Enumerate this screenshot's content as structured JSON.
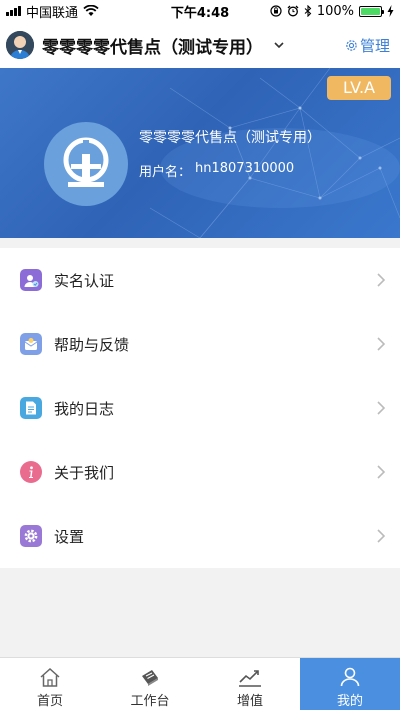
{
  "status_bar": {
    "carrier": "中国联通",
    "time": "下午4:48",
    "battery_percent": "100%",
    "battery_level": 1.0
  },
  "header": {
    "title": "零零零零代售点（测试专用）",
    "manage_label": "管理"
  },
  "banner": {
    "level_badge": "LV.A",
    "name": "零零零零代售点（测试专用）",
    "username_label": "用户名：",
    "username": "hn1807310000"
  },
  "menu": {
    "items": [
      {
        "label": "实名认证",
        "icon": "id-verify-icon",
        "color": "#8c6cd6"
      },
      {
        "label": "帮助与反馈",
        "icon": "help-feedback-icon",
        "color": "#7fa0e6"
      },
      {
        "label": "我的日志",
        "icon": "log-icon",
        "color": "#49a8e0"
      },
      {
        "label": "关于我们",
        "icon": "info-icon",
        "color": "#e96c8f"
      },
      {
        "label": "设置",
        "icon": "settings-icon",
        "color": "#9a78d6"
      }
    ]
  },
  "tabbar": {
    "tabs": [
      {
        "label": "首页",
        "icon": "home-icon",
        "active": false
      },
      {
        "label": "工作台",
        "icon": "workbench-icon",
        "active": false
      },
      {
        "label": "增值",
        "icon": "chart-icon",
        "active": false
      },
      {
        "label": "我的",
        "icon": "user-icon",
        "active": true
      }
    ]
  },
  "colors": {
    "accent": "#3d7fd6",
    "tab_active": "#4a8fe0",
    "badge": "#f0b860"
  }
}
